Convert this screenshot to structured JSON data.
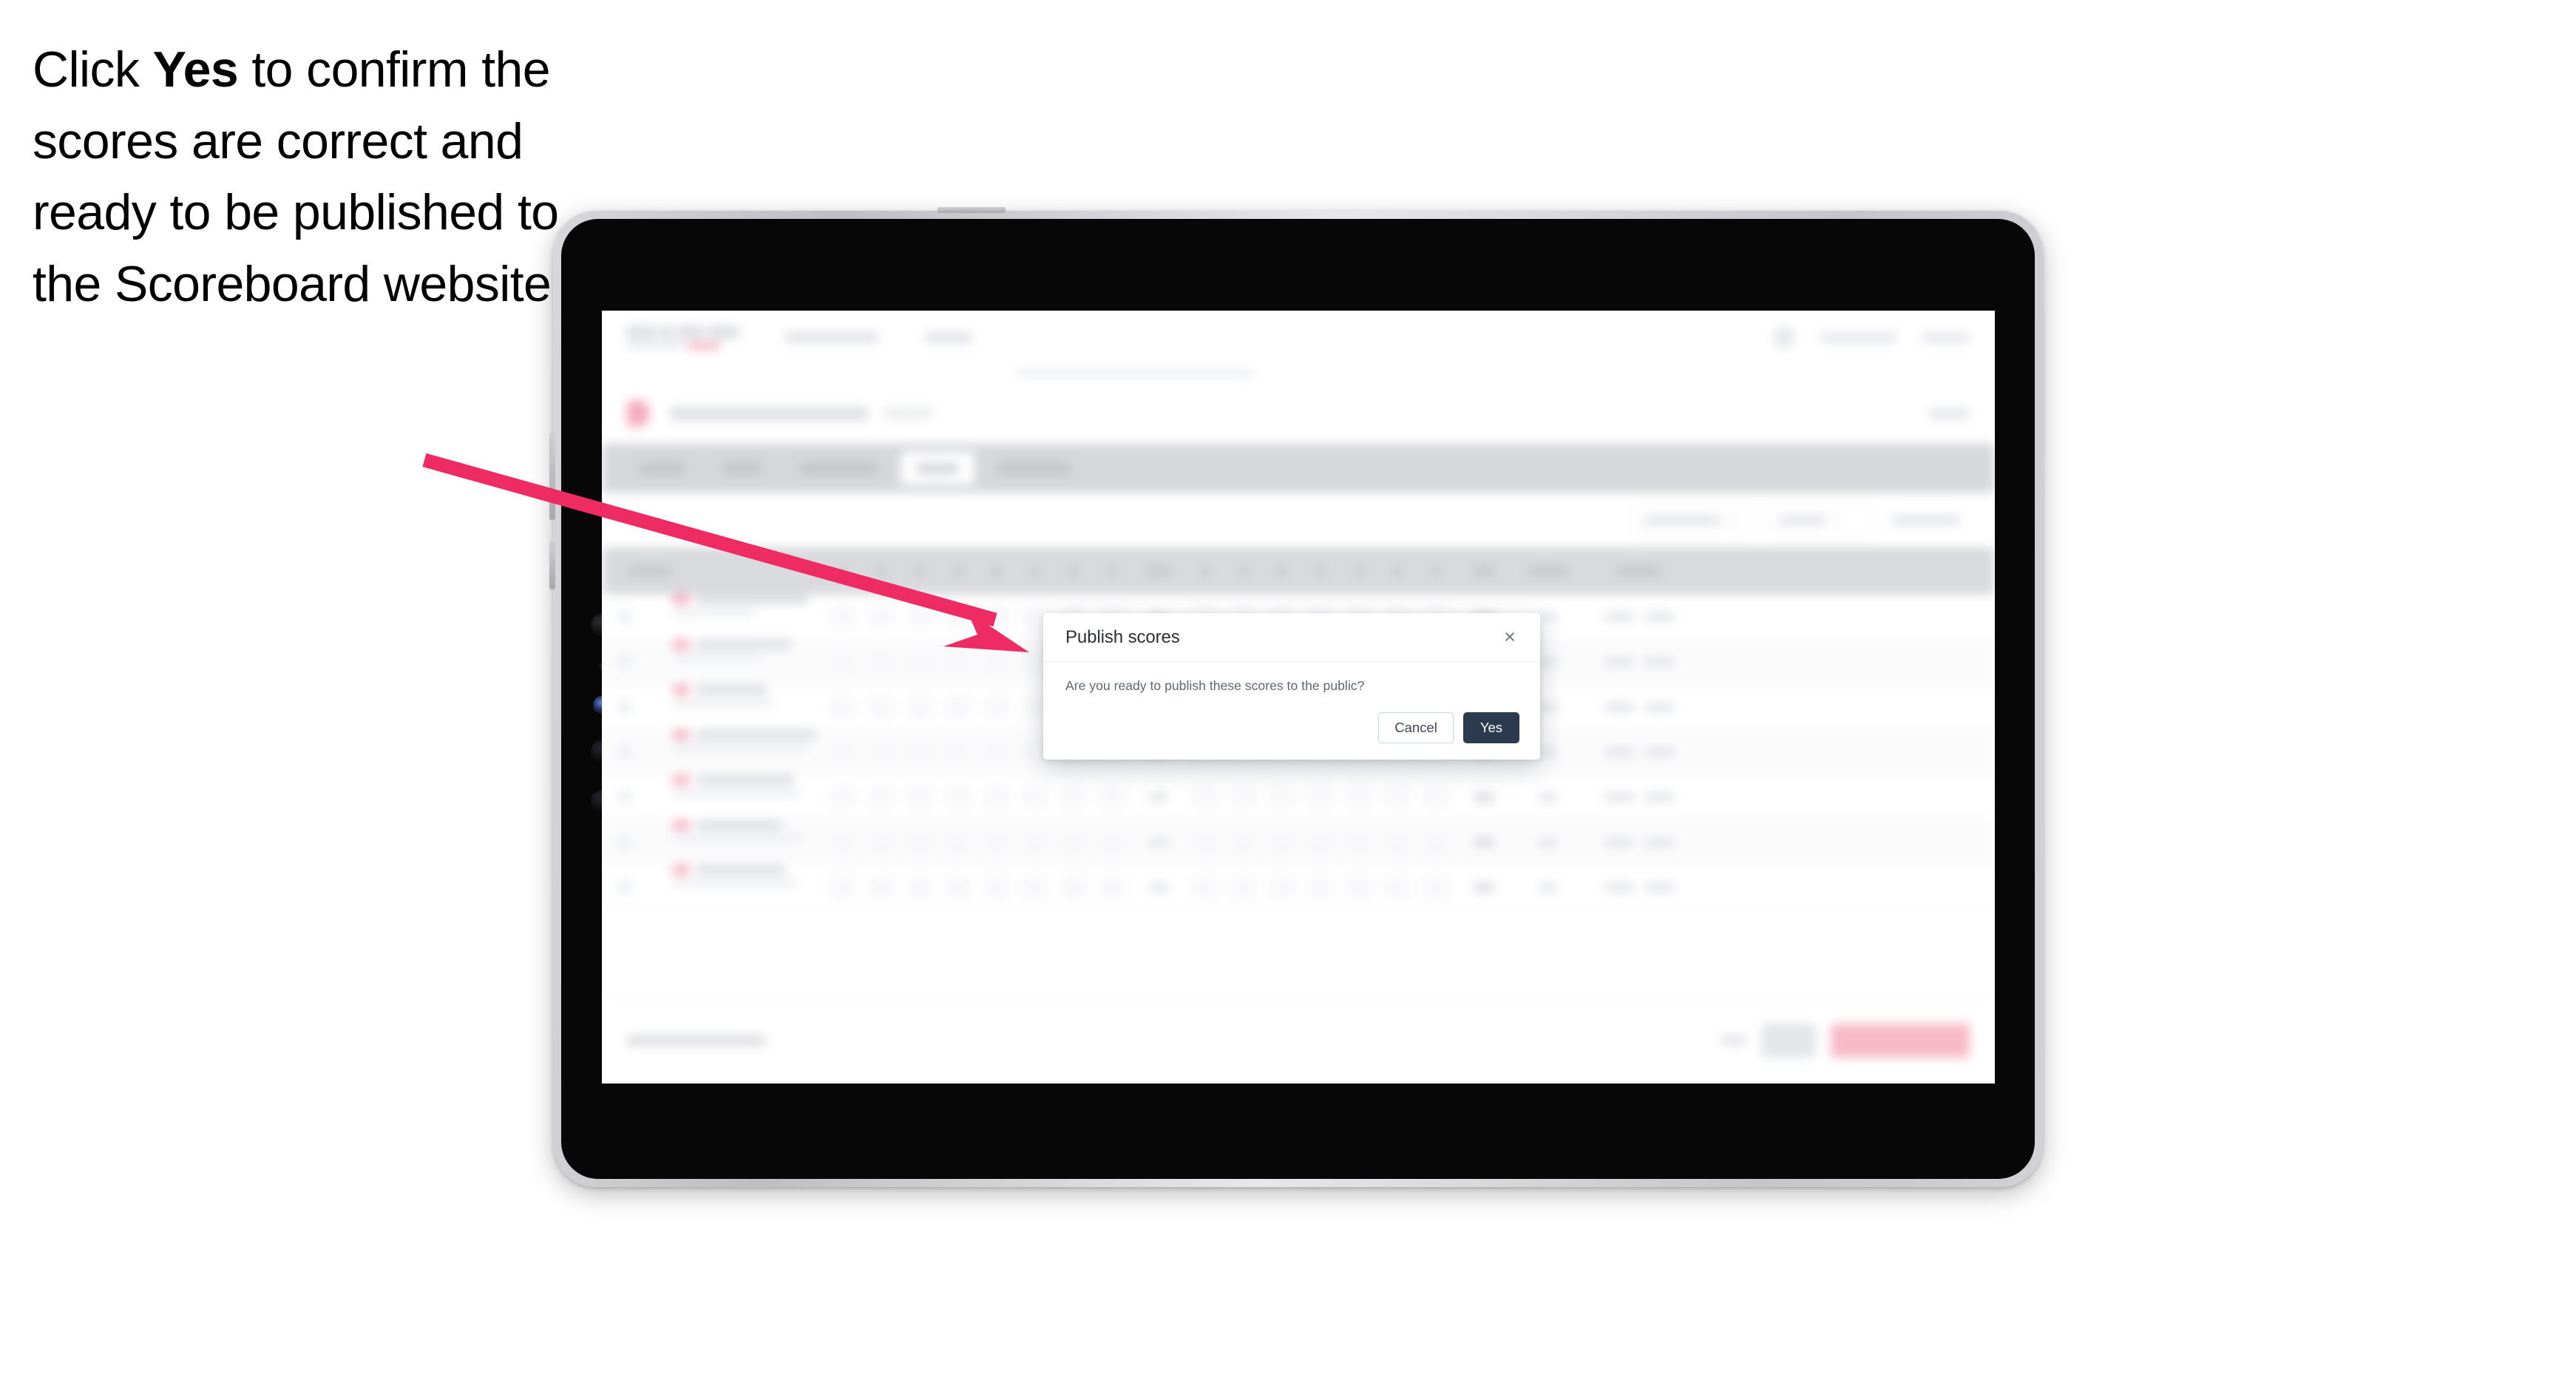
{
  "caption": {
    "before": "Click ",
    "emphasis": "Yes",
    "after": " to confirm the scores are correct and ready to be published to the Scoreboard website."
  },
  "annotation": {
    "arrow_color": "#EE2B62",
    "arrow_points_to": "yes-button"
  },
  "device": {
    "type": "tablet",
    "orientation": "landscape",
    "bezel_color": "#0a0a0a",
    "frame_color": "#cfcfd3"
  },
  "dialog": {
    "title": "Publish scores",
    "message": "Are you ready to publish these scores to the public?",
    "close_icon": "×",
    "close_icon_name": "close-icon",
    "cancel_label": "Cancel",
    "yes_label": "Yes",
    "yes_bg": "#2C3A50",
    "cancel_border": "#C8D6EA"
  },
  "background_app": {
    "state": "blurred",
    "accent_color": "#EE2B62",
    "topbar": {
      "nav_links": 2,
      "right_items": 2,
      "has_avatar": true
    },
    "event_row": {
      "has_icon": true,
      "icon_color": "#F5A8BD"
    },
    "tabs": {
      "count": 5,
      "active_index": 3,
      "strip_bg": "#D5D6DA"
    },
    "filters": {
      "count": 3
    },
    "table": {
      "header_bg": "#D8D9DD",
      "row_count": 7,
      "score_columns": 16,
      "summary_columns": 3
    },
    "bottom_bar": {
      "has_note": true,
      "secondary_button": true,
      "primary_button": true,
      "primary_button_color": "#F7B7C6"
    }
  }
}
